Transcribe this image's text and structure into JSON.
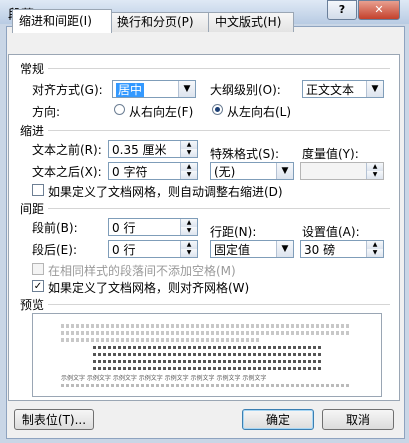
{
  "window": {
    "title": "段落",
    "help_glyph": "?",
    "close_glyph": "✕"
  },
  "tabs": [
    {
      "label": "缩进和间距(I)"
    },
    {
      "label": "换行和分页(P)"
    },
    {
      "label": "中文版式(H)"
    }
  ],
  "general": {
    "section": "常规",
    "align_label": "对齐方式(G):",
    "align_value": "居中",
    "outline_label": "大纲级别(O):",
    "outline_value": "正文文本",
    "direction_label": "方向:",
    "rtl_label": "从右向左(F)",
    "ltr_label": "从左向右(L)"
  },
  "indent": {
    "section": "缩进",
    "before_label": "文本之前(R):",
    "before_value": "0.35 厘米",
    "after_label": "文本之后(X):",
    "after_value": "0 字符",
    "special_label": "特殊格式(S):",
    "special_value": "(无)",
    "measure_label": "度量值(Y):",
    "measure_value": "",
    "grid_check_label": "如果定义了文档网格，则自动调整右缩进(D)"
  },
  "spacing": {
    "section": "间距",
    "before_label": "段前(B):",
    "before_value": "0 行",
    "after_label": "段后(E):",
    "after_value": "0 行",
    "line_label": "行距(N):",
    "line_value": "固定值",
    "setting_label": "设置值(A):",
    "setting_value": "30 磅",
    "no_space_label": "在相同样式的段落间不添加空格(M)",
    "snap_grid_label": "如果定义了文档网格，则对齐网格(W)"
  },
  "preview": {
    "section": "预览",
    "sample_text": "示例文字 示例文字 示例文字 示例文字 示例文字 示例文字 示例文字 示例文字"
  },
  "buttons": {
    "tabs_label": "制表位(T)...",
    "ok_label": "确定",
    "cancel_label": "取消"
  },
  "glyphs": {
    "dropdown": "▼",
    "spin_up": "▲",
    "spin_down": "▼",
    "check": "✓"
  }
}
